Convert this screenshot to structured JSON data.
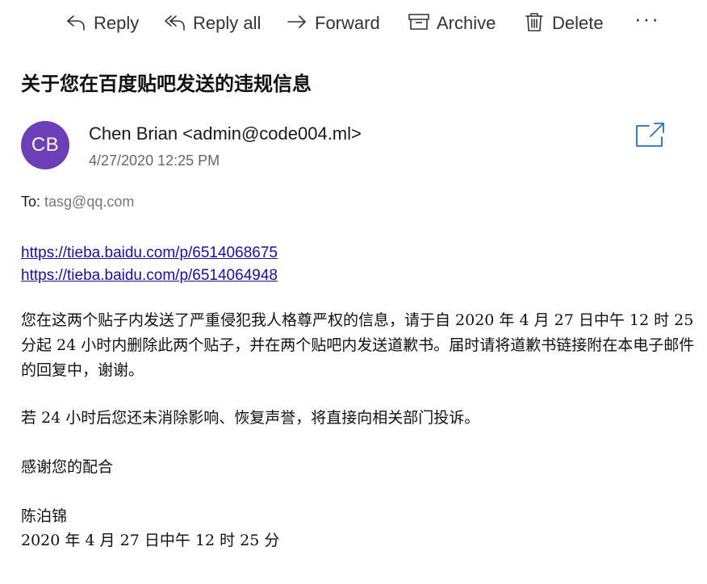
{
  "toolbar": {
    "reply": "Reply",
    "reply_all": "Reply all",
    "forward": "Forward",
    "archive": "Archive",
    "delete": "Delete",
    "more": "···"
  },
  "message": {
    "subject": "关于您在百度贴吧发送的违规信息",
    "avatar_initials": "CB",
    "avatar_color": "#6a3fb8",
    "sender": "Chen Brian <admin@code004.ml>",
    "date": "4/27/2020 12:25 PM",
    "to_label": "To:",
    "to_address": "tasg@qq.com",
    "links": [
      "https://tieba.baidu.com/p/6514068675",
      "https://tieba.baidu.com/p/6514064948"
    ],
    "paragraphs": [
      "您在这两个贴子内发送了严重侵犯我人格尊严权的信息，请于自 2020 年 4 月 27 日中午 12 时 25 分起 24 小时内删除此两个贴子，并在两个贴吧内发送道歉书。届时请将道歉书链接附在本电子邮件的回复中，谢谢。",
      "若 24 小时后您还未消除影响、恢复声誉，将直接向相关部门投诉。",
      "感谢您的配合",
      "陈泊锦",
      "2020 年 4 月 27 日中午 12 时 25 分"
    ]
  },
  "icons": {
    "reply": "reply-icon",
    "reply_all": "reply-all-icon",
    "forward": "forward-icon",
    "archive": "archive-icon",
    "delete": "delete-icon",
    "popout": "popout-icon"
  },
  "colors": {
    "link": "#1a0dab",
    "popout_icon": "#1f6fc5"
  }
}
